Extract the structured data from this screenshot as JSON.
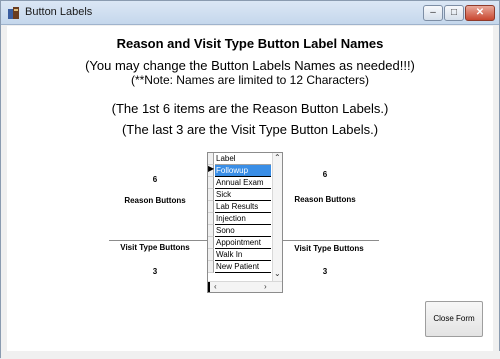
{
  "window": {
    "title": "Button Labels"
  },
  "headings": {
    "title": "Reason and Visit Type Button Label Names",
    "line1": "(You may change the Button Labels Names as needed!!!)",
    "line2": "(**Note: Names are limited to 12 Characters)",
    "line3": "(The 1st 6 items are the Reason Button Labels.)",
    "line4": "(The last 3 are the Visit Type Button Labels.)"
  },
  "left": {
    "reason_count": "6",
    "reason_label": "Reason Buttons",
    "visit_label": "Visit Type Buttons",
    "visit_count": "3"
  },
  "right": {
    "reason_count": "6",
    "reason_label": "Reason Buttons",
    "visit_label": "Visit Type Buttons",
    "visit_count": "3"
  },
  "grid": {
    "header": "Label",
    "rows": [
      "Followup",
      "Annual Exam",
      "Sick",
      "Lab Results",
      "Injection",
      "Sono",
      "Appointment",
      "Walk In",
      "New Patient"
    ],
    "selected_index": 0
  },
  "buttons": {
    "close_form": "Close Form"
  },
  "icons": [
    "app-icon",
    "minimize-icon",
    "maximize-icon",
    "close-icon",
    "scroll-up-icon",
    "scroll-down-icon",
    "scroll-left-icon",
    "scroll-right-icon",
    "row-pointer-icon"
  ]
}
